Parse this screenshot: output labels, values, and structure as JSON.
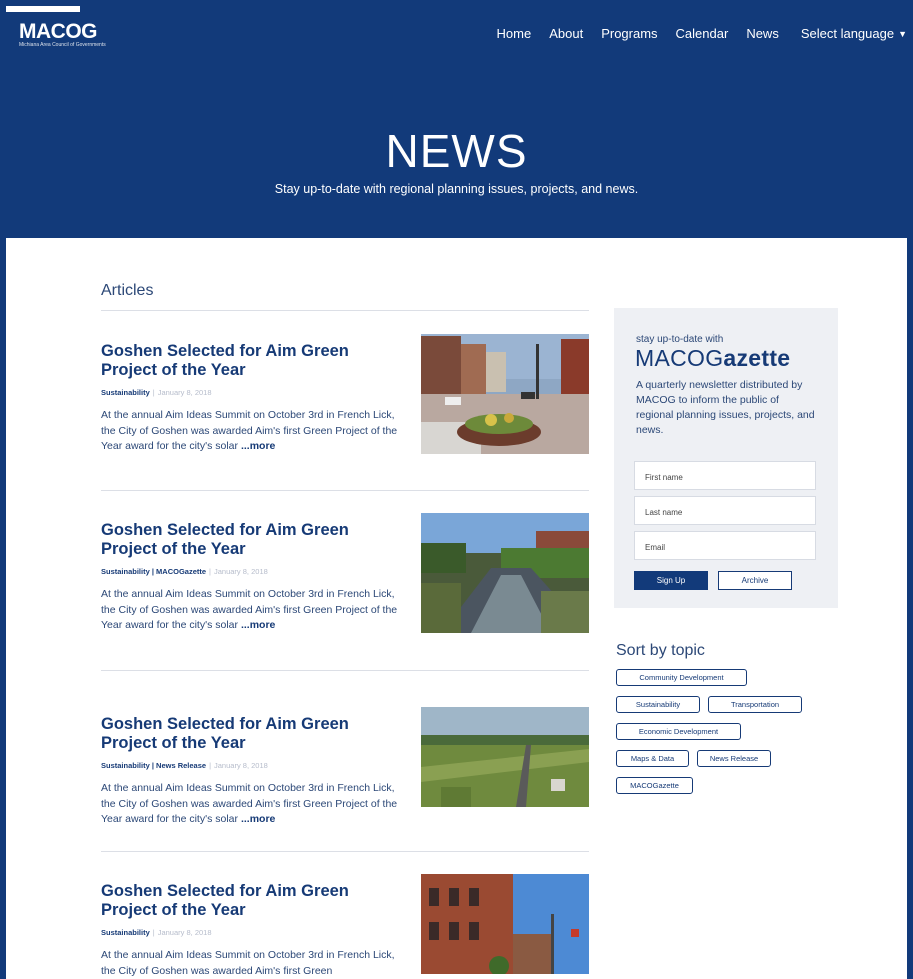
{
  "header": {
    "logo": "MACOG",
    "logo_tagline": "Michiana Area Council of Governments",
    "nav": [
      "Home",
      "About",
      "Programs",
      "Calendar",
      "News"
    ],
    "language": "Select language"
  },
  "hero": {
    "title": "NEWS",
    "subtitle": "Stay up-to-date with regional planning issues, projects, and news."
  },
  "articles_section": {
    "title": "Articles"
  },
  "articles": [
    {
      "title": "Goshen Selected for Aim Green Project of the Year",
      "categories": "Sustainability",
      "date": "January 8, 2018",
      "excerpt": "At the annual Aim Ideas Summit on October 3rd in French Lick, the City of Goshen was awarded Aim's first Green Project of the Year award for the city's solar",
      "more": "...more",
      "image": "street-planter-photo"
    },
    {
      "title": "Goshen Selected for Aim Green Project of the Year",
      "categories": "Sustainability | MACOGazette",
      "date": "January 8, 2018",
      "excerpt": "At the annual Aim Ideas Summit on October 3rd in French Lick, the City of Goshen was awarded Aim's first Green Project of the Year award for the city's solar",
      "more": "...more",
      "image": "river-town-photo"
    },
    {
      "title": "Goshen Selected for Aim Green Project of the Year",
      "categories": "Sustainability | News Release",
      "date": "January 8, 2018",
      "excerpt": "At the annual Aim Ideas Summit on October 3rd in French Lick, the City of Goshen was awarded Aim's first Green Project of the Year award for the city's solar",
      "more": "...more",
      "image": "aerial-field-photo"
    },
    {
      "title": "Goshen Selected for Aim Green Project of the Year",
      "categories": "Sustainability",
      "date": "January 8, 2018",
      "excerpt": "At the annual Aim Ideas Summit on October 3rd in French Lick, the City of Goshen was awarded Aim's first Green",
      "more": "",
      "image": "brick-building-photo"
    }
  ],
  "newsletter": {
    "kicker": "stay up-to-date with",
    "brand_light": "MACOG",
    "brand_bold": "azette",
    "description": "A quarterly newsletter distributed by MACOG to inform the public of regional planning issues, projects, and news.",
    "first_name_placeholder": "First name",
    "last_name_placeholder": "Last name",
    "email_placeholder": "Email",
    "signup_label": "Sign Up",
    "archive_label": "Archive"
  },
  "topics": {
    "title": "Sort by topic",
    "items": [
      "Community Development",
      "Sustainability",
      "Transportation",
      "Economic Development",
      "Maps & Data",
      "News Release",
      "MACOGazette"
    ]
  },
  "colors": {
    "brand_navy": "#123a7a",
    "text_navy": "#163a76",
    "card_bg": "#eef0f4"
  }
}
